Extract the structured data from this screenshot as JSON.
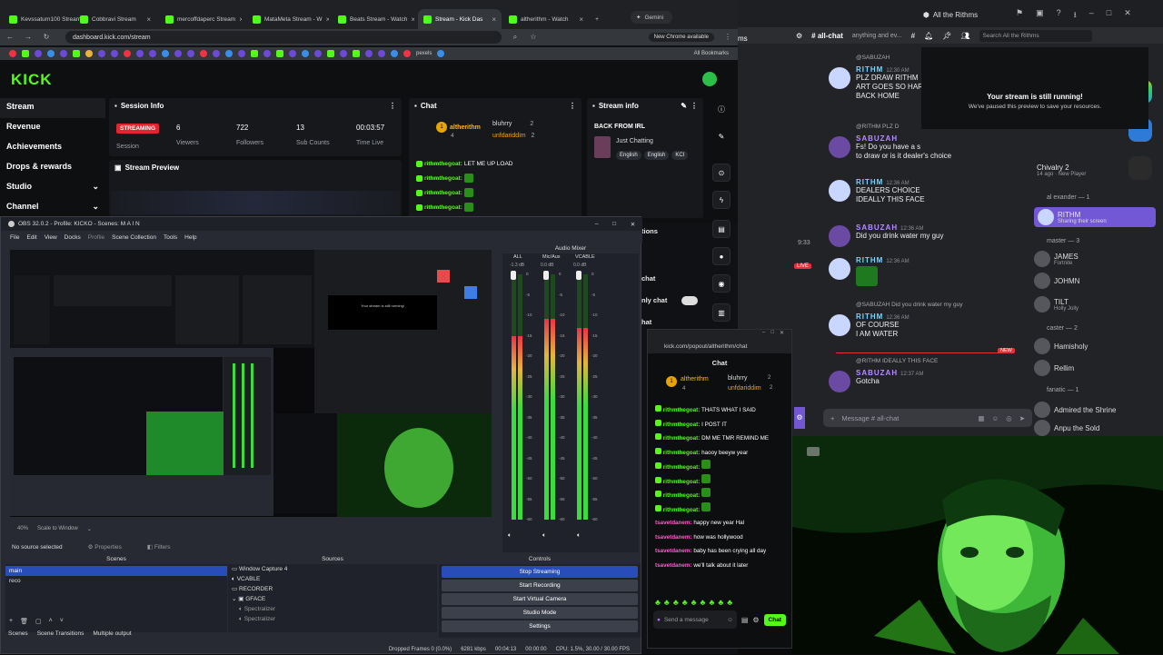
{
  "browser": {
    "tabs": [
      {
        "label": "Kevssaturn100 Stream"
      },
      {
        "label": "Cobbravi Stream"
      },
      {
        "label": "mercoffdaperc Stream"
      },
      {
        "label": "MataMeta Stream - W"
      },
      {
        "label": "Beats Stream - Watch"
      },
      {
        "label": "Stream - Kick Das"
      },
      {
        "label": "altherithm - Watch"
      }
    ],
    "gemini_label": "Gemini",
    "url": "dashboard.kick.com/stream",
    "new_chrome_badge": "New Chrome available",
    "all_bookmarks": "All Bookmarks",
    "bookmark_text": "pexels"
  },
  "kick": {
    "logo": "KICK",
    "nav": [
      {
        "label": "Stream",
        "chevron": ""
      },
      {
        "label": "Revenue",
        "chevron": ""
      },
      {
        "label": "Achievements",
        "chevron": ""
      },
      {
        "label": "Drops & rewards",
        "chevron": ""
      },
      {
        "label": "Studio",
        "chevron": "⌄"
      },
      {
        "label": "Channel",
        "chevron": "⌄"
      }
    ],
    "session": {
      "title": "Session Info",
      "status_badge": "STREAMING",
      "session_label": "Session",
      "stats": [
        {
          "value": "6",
          "label": "Viewers"
        },
        {
          "value": "722",
          "label": "Followers"
        },
        {
          "value": "13",
          "label": "Sub Counts"
        },
        {
          "value": "00:03:57",
          "label": "Time Live"
        }
      ]
    },
    "preview_title": "Stream Preview",
    "chat": {
      "title": "Chat",
      "top_users": [
        {
          "rank": "1",
          "name": "altherithm",
          "count": "4"
        },
        {
          "rank": "",
          "name": "bluhrry",
          "count": "2"
        },
        {
          "rank": "",
          "name": "unfdariddim",
          "count": "2"
        }
      ],
      "messages": [
        {
          "user": "rithmthegoat:",
          "text": "LET ME UP LOAD"
        },
        {
          "user": "rithmthegoat:",
          "text": ""
        },
        {
          "user": "rithmthegoat:",
          "text": ""
        },
        {
          "user": "rithmthegoat:",
          "text": ""
        }
      ]
    },
    "stream_info": {
      "title": "Stream info",
      "stream_title": "BACK FROM IRL",
      "category": "Just Chatting",
      "tags": [
        "English",
        "English",
        "KCI"
      ],
      "actions_label": "tions",
      "menu_items": [
        "chat",
        "nly chat",
        "hat"
      ]
    }
  },
  "obs": {
    "title": "OBS 32.0.2 - Profile: KICKO - Scenes: M A I N",
    "menu": [
      "File",
      "Edit",
      "View",
      "Docks",
      "Profile",
      "Scene Collection",
      "Tools",
      "Help"
    ],
    "preview_zoom": "40%",
    "scale_label": "Scale to Window",
    "no_source": "No source selected",
    "properties_label": "Properties",
    "filters_label": "Filters",
    "audio_mixer": {
      "title": "Audio Mixer",
      "channels": [
        {
          "name": "ALL",
          "db": "-1.3 dB",
          "level": 0.75
        },
        {
          "name": "Mic/Aux",
          "db": "0.0 dB",
          "level": 0.82
        },
        {
          "name": "VCABLE",
          "db": "0.0 dB",
          "level": 0.78
        }
      ],
      "scale": [
        "0",
        "-5",
        "-10",
        "-15",
        "-20",
        "-25",
        "-30",
        "-35",
        "-40",
        "-45",
        "-50",
        "-55",
        "-60"
      ]
    },
    "scenes": {
      "title": "Scenes",
      "items": [
        "main",
        "reco"
      ]
    },
    "sources": {
      "title": "Sources",
      "items": [
        "Window Capture 4",
        "VCABLE",
        "RECORDER",
        "GFACE",
        "Spectralizer",
        "Spectralizer"
      ]
    },
    "controls": {
      "title": "Controls",
      "buttons": [
        "Stop Streaming",
        "Start Recording",
        "Start Virtual Camera",
        "Studio Mode",
        "Settings"
      ]
    },
    "bottom_tabs": [
      "Scenes",
      "Scene Transitions",
      "Multiple output"
    ],
    "status": {
      "dropped": "Dropped Frames 0 (0.0%)",
      "kbps": "6281 kbps",
      "time": "00:04:13",
      "rec_time": "00:00:00",
      "cpu": "CPU: 1.5%, 30.00 / 30.00 FPS"
    }
  },
  "popout": {
    "url": "kick.com/popout/altherithm/chat",
    "title": "Chat",
    "top_users": [
      {
        "rank": "1",
        "name": "altherithm",
        "count": "4"
      },
      {
        "rank": "",
        "name": "bluhrry",
        "count": "2"
      },
      {
        "rank": "",
        "name": "unfdariddim",
        "count": "2"
      }
    ],
    "messages": [
      {
        "user": "rithmthegoat:",
        "text": "THATS WHAT I SAID",
        "pink": false
      },
      {
        "user": "rithmthegoat:",
        "text": "I POST IT",
        "pink": false
      },
      {
        "user": "rithmthegoat:",
        "text": "DM ME TMR REMIND ME",
        "pink": false
      },
      {
        "user": "rithmthegoat:",
        "text": "haooy beeyw year",
        "pink": false
      },
      {
        "user": "rithmthegoat:",
        "text": "",
        "pink": false
      },
      {
        "user": "rithmthegoat:",
        "text": "",
        "pink": false
      },
      {
        "user": "rithmthegoat:",
        "text": "",
        "pink": false
      },
      {
        "user": "rithmthegoat:",
        "text": "",
        "pink": false
      },
      {
        "user": "tsavetdanem:",
        "text": "happy new year Hal",
        "pink": true
      },
      {
        "user": "tsavetdanem:",
        "text": "how was hollywood",
        "pink": true
      },
      {
        "user": "tsavetdanem:",
        "text": "baby has been crying all day",
        "pink": true
      },
      {
        "user": "tsavetdanem:",
        "text": "we'll talk about it later",
        "pink": true
      }
    ],
    "input_placeholder": "Send a message",
    "chat_button": "Chat"
  },
  "discord": {
    "title": "All the Rithms",
    "channel": "# all-chat",
    "topic": "anything and ev...",
    "search_placeholder": "Search All the Rithms",
    "overlay_title": "Your stream is still running!",
    "overlay_sub": "We've paused this preview to save your resources.",
    "messages": [
      {
        "name": "RITHM",
        "time": "12:30 AM",
        "lines": [
          "PLZ DRAW RITHM",
          "ART GOES SO HAR",
          "BACK HOME"
        ],
        "reply": "@SABUZAH"
      },
      {
        "name": "SABUZAH",
        "time": "",
        "lines": [
          "Fs! Do you have a s",
          "to draw or is it dealer's choice"
        ],
        "reply": "@RITHM PLZ D"
      },
      {
        "name": "RITHM",
        "time": "12:36 AM",
        "lines": [
          "DEALERS CHOICE",
          "IDEALLY THIS FACE"
        ],
        "reply": ""
      },
      {
        "name": "SABUZAH",
        "time": "12:36 AM",
        "lines": [
          "Did you drink water my guy"
        ],
        "reply": ""
      },
      {
        "name": "RITHM",
        "time": "12:36 AM",
        "lines": [
          ""
        ],
        "reply": ""
      },
      {
        "name": "RITHM",
        "time": "12:36 AM",
        "lines": [
          "OF COURSE",
          "I AM WATER"
        ],
        "reply": "@SABUZAH Did you drink water my guy"
      },
      {
        "name": "SABUZAH",
        "time": "12:37 AM",
        "lines": [
          "Gotcha"
        ],
        "reply": "@RITHM IDEALLY THIS FACE"
      }
    ],
    "new_badge": "NEW",
    "input_placeholder": "Message # all-chat",
    "left_labels": {
      "time": "9:33",
      "live": "LIVE"
    },
    "members": [
      {
        "name": "Chivalry 2",
        "sub": "14 ago · New Player"
      },
      {
        "name": "al exander — 1",
        "sub": ""
      },
      {
        "name": "RITHM",
        "sub": "Sharing their screen"
      },
      {
        "name": "master — 3",
        "sub": ""
      },
      {
        "name": "JAMES",
        "sub": "Fortnite"
      },
      {
        "name": "JOHMN",
        "sub": ""
      },
      {
        "name": "TILT",
        "sub": "Holly Jolly"
      },
      {
        "name": "caster — 2",
        "sub": ""
      },
      {
        "name": "Hamisholy",
        "sub": ""
      },
      {
        "name": "Rellim",
        "sub": ""
      },
      {
        "name": "fanatic — 1",
        "sub": ""
      },
      {
        "name": "Admired the Shrine",
        "sub": ""
      },
      {
        "name": "Anpu the Sold",
        "sub": ""
      }
    ]
  }
}
